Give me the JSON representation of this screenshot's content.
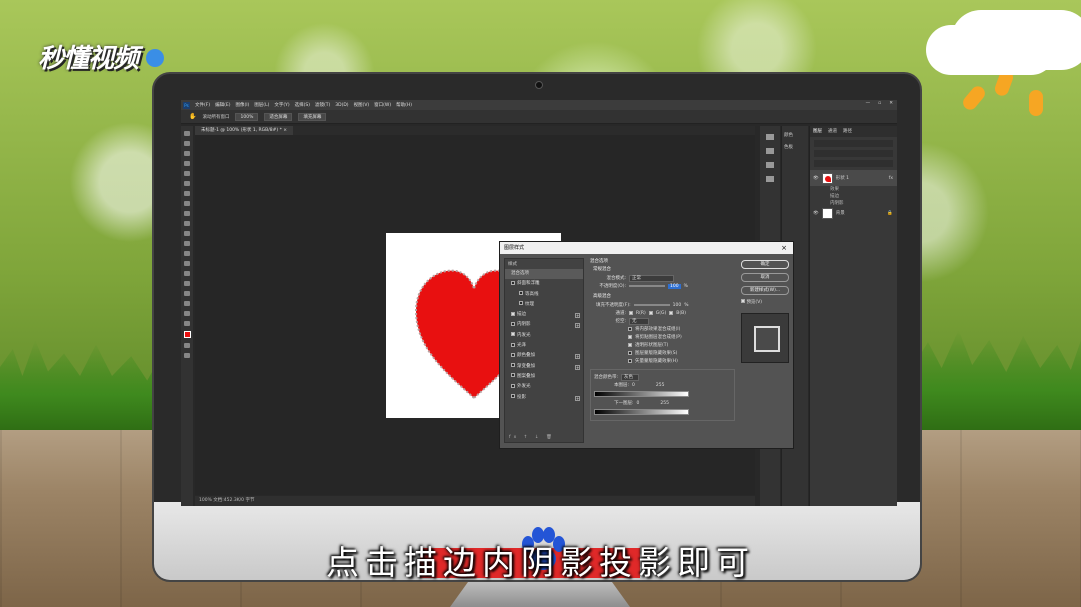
{
  "watermark": {
    "logo_text": "秒懂视频"
  },
  "subtitle": "点击描边内阴影投影即可",
  "photoshop": {
    "menu": [
      "文件(F)",
      "编辑(E)",
      "图像(I)",
      "图层(L)",
      "文字(Y)",
      "选择(S)",
      "滤镜(T)",
      "3D(D)",
      "视图(V)",
      "窗口(W)",
      "帮助(H)"
    ],
    "window_controls": [
      "—",
      "▫",
      "✕"
    ],
    "options_bar": {
      "scroll_all": "滚动所有窗口",
      "zoom": "100%",
      "fit_screen": "适合屏幕",
      "fill_screen": "填充屏幕"
    },
    "doc_tab": "未标题-1 @ 100% (形状 1, RGB/8#) * ×",
    "status": "100%      文档:452.3K/0 字节",
    "right_mini_panel": [
      "颜色",
      "色板"
    ],
    "layers_panel": {
      "tabs": [
        "图层",
        "通道",
        "路径"
      ],
      "layers": [
        {
          "name": "形状 1",
          "effects_label": "效果",
          "effects": [
            "描边",
            "内阴影"
          ]
        },
        {
          "name": "背景"
        }
      ]
    },
    "layer_style_dialog": {
      "title": "图层样式",
      "styles_header": "样式",
      "styles": [
        {
          "label": "混合选项",
          "checked": null,
          "plus": false,
          "highlight": true
        },
        {
          "label": "斜面和浮雕",
          "checked": false,
          "plus": false
        },
        {
          "label": "等高线",
          "checked": false,
          "plus": false
        },
        {
          "label": "纹理",
          "checked": false,
          "plus": false
        },
        {
          "label": "描边",
          "checked": true,
          "plus": true
        },
        {
          "label": "内阴影",
          "checked": false,
          "plus": true
        },
        {
          "label": "内发光",
          "checked": true,
          "plus": false
        },
        {
          "label": "光泽",
          "checked": false,
          "plus": false
        },
        {
          "label": "颜色叠加",
          "checked": false,
          "plus": true
        },
        {
          "label": "渐变叠加",
          "checked": false,
          "plus": true
        },
        {
          "label": "图案叠加",
          "checked": false,
          "plus": false
        },
        {
          "label": "外发光",
          "checked": false,
          "plus": false
        },
        {
          "label": "投影",
          "checked": false,
          "plus": true
        }
      ],
      "footer_icons": "fx ↑ ↓ 🗑",
      "blend": {
        "group_title": "混合选项",
        "general_title": "常规混合",
        "blend_mode_label": "混合模式:",
        "blend_mode_value": "正常",
        "opacity_label": "不透明度(O):",
        "opacity_value": "100",
        "percent": "%",
        "advanced_title": "高级混合",
        "fill_opacity_label": "填充不透明度(F):",
        "fill_opacity_value": "100",
        "channels_label": "通道:",
        "channels": [
          "R(R)",
          "G(G)",
          "B(B)"
        ],
        "knockout_label": "挖空:",
        "knockout_value": "无",
        "checks": [
          {
            "label": "将内部效果混合成组(I)",
            "checked": false
          },
          {
            "label": "将剪贴图层混合成组(P)",
            "checked": true
          },
          {
            "label": "透明形状图层(T)",
            "checked": true
          },
          {
            "label": "图层蒙版隐藏效果(S)",
            "checked": false
          },
          {
            "label": "矢量蒙版隐藏效果(H)",
            "checked": false
          }
        ],
        "blend_if_label": "混合颜色带:",
        "blend_if_value": "灰色",
        "this_layer_label": "本图层:",
        "this_layer_values": [
          "0",
          "255"
        ],
        "underlying_label": "下一图层:",
        "underlying_values": [
          "0",
          "255"
        ]
      },
      "buttons": {
        "ok": "确定",
        "cancel": "取消",
        "new_style": "新建样式(W)...",
        "preview": "预览(V)"
      },
      "preview_checked": true
    }
  },
  "colors": {
    "heart": "#e81010",
    "ps_dark": "#282828",
    "subtitle_banner": "#e02020"
  }
}
